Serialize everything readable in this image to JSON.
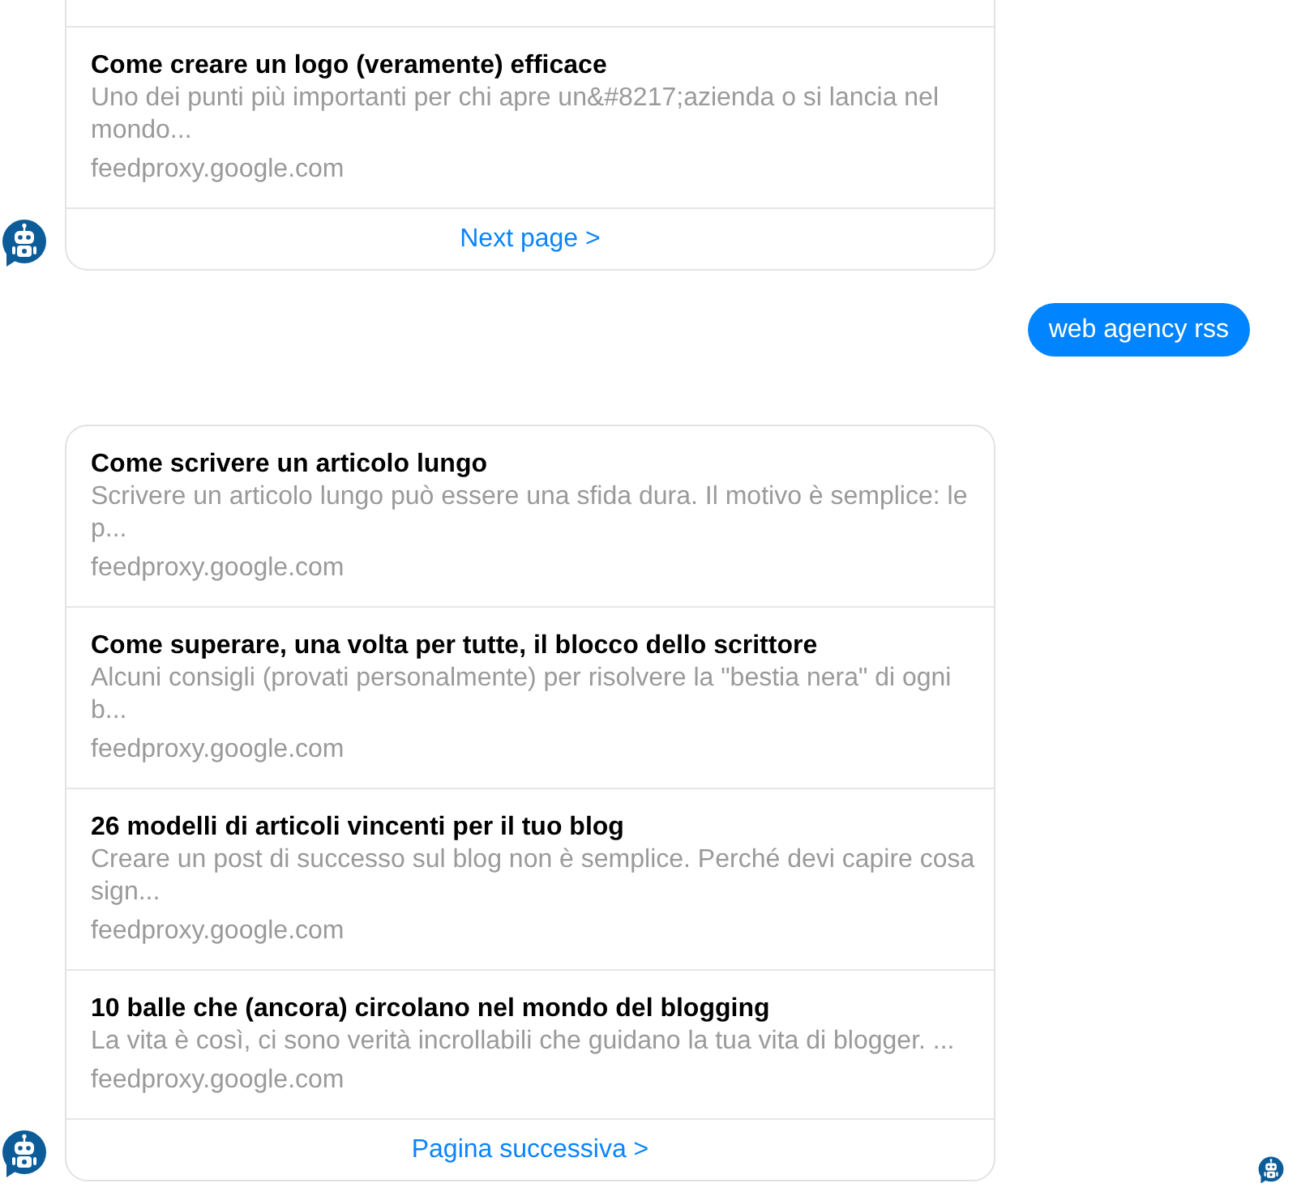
{
  "messages": [
    {
      "kind": "card_list",
      "clipped": true,
      "items": [
        {
          "title": "Come creare un logo (veramente) efficace",
          "description": "Uno dei punti più importanti per chi apre un&#8217;azienda o si lancia nel mondo...",
          "source": "feedproxy.google.com"
        }
      ],
      "footer_link": "Next page >"
    },
    {
      "kind": "text",
      "text": "web agency rss"
    },
    {
      "kind": "card_list",
      "clipped": false,
      "items": [
        {
          "title": "Come scrivere un articolo lungo",
          "description": "Scrivere un articolo lungo può essere una sfida dura. Il motivo è semplice: le p...",
          "source": "feedproxy.google.com"
        },
        {
          "title": "Come superare, una volta per tutte, il blocco dello scrittore",
          "description": "Alcuni consigli (provati personalmente) per risolvere la \"bestia nera\" di ogni b...",
          "source": "feedproxy.google.com"
        },
        {
          "title": "26 modelli di articoli vincenti per il tuo blog",
          "description": "Creare un post di successo sul blog non è semplice. Perché devi capire cosa sign...",
          "source": "feedproxy.google.com"
        },
        {
          "title": "10 balle che (ancora) circolano nel mondo del blogging",
          "description": "La vita è così, ci sono verità incrollabili che guidano la tua vita di blogger. ...",
          "source": "feedproxy.google.com"
        }
      ],
      "footer_link": "Pagina successiva >"
    }
  ],
  "read_receipt": true
}
